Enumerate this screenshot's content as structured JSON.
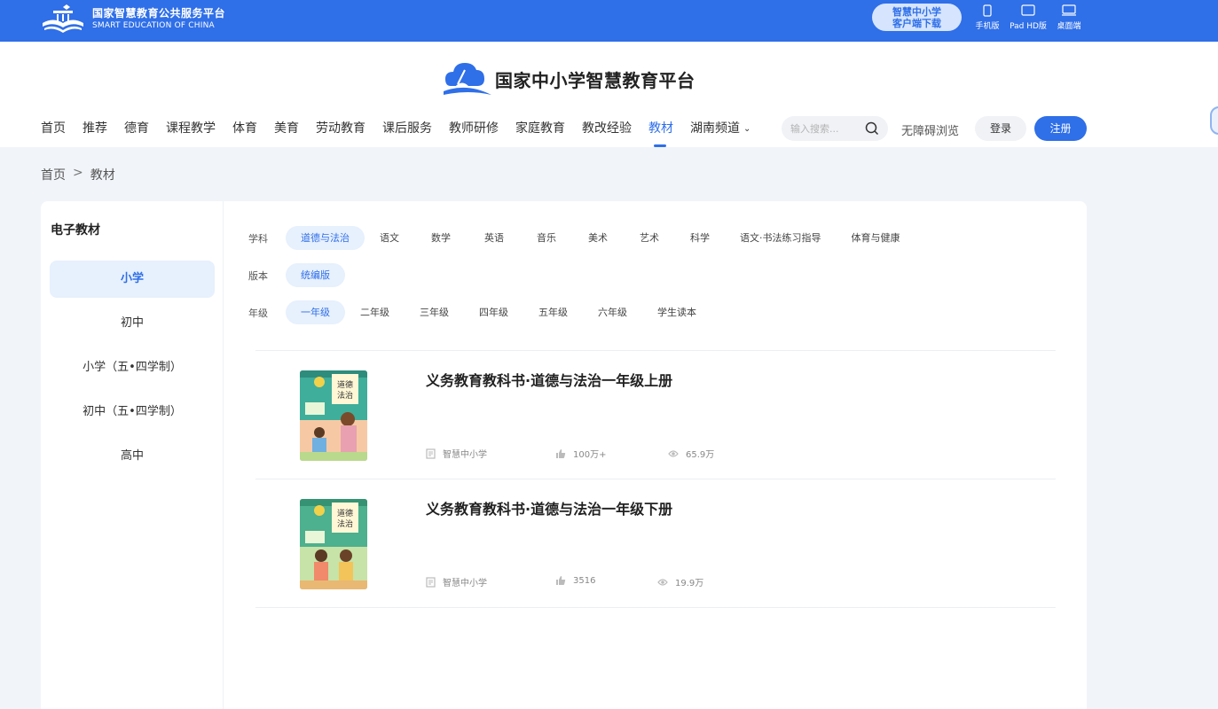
{
  "topbar": {
    "brand_cn": "国家智慧教育公共服务平台",
    "brand_en": "SMART EDUCATION OF CHINA",
    "client_line1": "智慧中小学",
    "client_line2": "客户端下载",
    "devices": {
      "phone": "手机版",
      "pad": "Pad HD版",
      "desktop": "桌面端"
    }
  },
  "header": {
    "site_title": "国家中小学智慧教育平台",
    "nav": [
      "首页",
      "推荐",
      "德育",
      "课程教学",
      "体育",
      "美育",
      "劳动教育",
      "课后服务",
      "教师研修",
      "家庭教育",
      "教改经验",
      "教材",
      "湖南频道"
    ],
    "active_nav": "教材",
    "search_placeholder": "输入搜索...",
    "accessibility": "无障碍浏览",
    "login": "登录",
    "register": "注册"
  },
  "breadcrumb": {
    "home": "首页",
    "sep": ">",
    "current": "教材"
  },
  "sidebar": {
    "title": "电子教材",
    "items": [
      "小学",
      "初中",
      "小学（五•四学制）",
      "初中（五•四学制）",
      "高中"
    ],
    "active": "小学"
  },
  "filters": {
    "subject": {
      "label": "学科",
      "options": [
        "道德与法治",
        "语文",
        "数学",
        "英语",
        "音乐",
        "美术",
        "艺术",
        "科学",
        "语文·书法练习指导",
        "体育与健康"
      ],
      "active": "道德与法治"
    },
    "edition": {
      "label": "版本",
      "options": [
        "统编版"
      ],
      "active": "统编版"
    },
    "grade": {
      "label": "年级",
      "options": [
        "一年级",
        "二年级",
        "三年级",
        "四年级",
        "五年级",
        "六年级",
        "学生读本"
      ],
      "active": "一年级"
    }
  },
  "books": [
    {
      "title": "义务教育教科书·道德与法治一年级上册",
      "publisher": "智慧中小学",
      "likes": "100万+",
      "views": "65.9万",
      "cover_text": "道德与法治"
    },
    {
      "title": "义务教育教科书·道德与法治一年级下册",
      "publisher": "智慧中小学",
      "likes": "3516",
      "views": "19.9万",
      "cover_text": "道德与法治"
    }
  ],
  "colors": {
    "primary": "#2f6fe8",
    "chip_active_bg": "#e7f0fd",
    "page_bg": "#f1f4f9"
  }
}
